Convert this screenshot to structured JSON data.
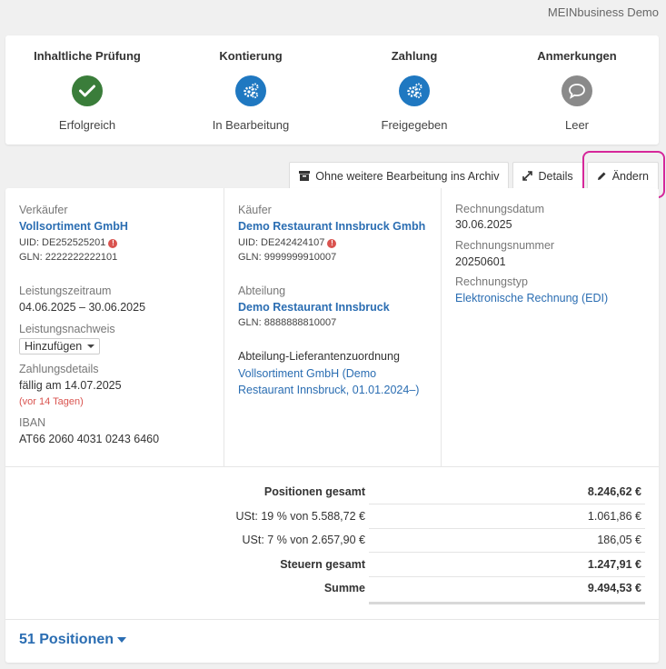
{
  "brand": "MEINbusiness Demo",
  "steps": [
    {
      "title": "Inhaltliche Prüfung",
      "status": "Erfolgreich",
      "icon": "check-icon",
      "color": "#3a7d3a"
    },
    {
      "title": "Kontierung",
      "status": "In Bearbeitung",
      "icon": "gears-icon",
      "color": "#1f78c1"
    },
    {
      "title": "Zahlung",
      "status": "Freigegeben",
      "icon": "gears-icon",
      "color": "#1f78c1"
    },
    {
      "title": "Anmerkungen",
      "status": "Leer",
      "icon": "comment-icon",
      "color": "#8a8a8a"
    }
  ],
  "tabs": {
    "archive": "Ohne weitere Bearbeitung ins Archiv",
    "details": "Details",
    "edit": "Ändern"
  },
  "seller": {
    "label": "Verkäufer",
    "name": "Vollsortiment GmbH",
    "uid": "UID: DE252525201",
    "gln": "GLN: 2222222222101"
  },
  "period": {
    "label": "Leistungszeitraum",
    "value": "04.06.2025 – 30.06.2025"
  },
  "proof": {
    "label": "Leistungsnachweis",
    "button": "Hinzufügen"
  },
  "payment": {
    "label": "Zahlungsdetails",
    "due": "fällig am 14.07.2025",
    "overdue": "(vor 14 Tagen)"
  },
  "iban": {
    "label": "IBAN",
    "value": "AT66 2060 4031 0243 6460"
  },
  "buyer": {
    "label": "Käufer",
    "name": "Demo Restaurant Innsbruck Gmbh",
    "uid": "UID: DE242424107",
    "gln": "GLN: 9999999910007"
  },
  "department": {
    "label": "Abteilung",
    "name": "Demo Restaurant Innsbruck",
    "gln": "GLN: 8888888810007"
  },
  "supplier_assignment": {
    "label": "Abteilung-Lieferantenzuordnung",
    "line1": "Vollsortiment GmbH (Demo",
    "line2": "Restaurant Innsbruck, 01.01.2024–)"
  },
  "invoice": {
    "date_label": "Rechnungsdatum",
    "date": "30.06.2025",
    "number_label": "Rechnungsnummer",
    "number": "20250601",
    "type_label": "Rechnungstyp",
    "type": "Elektronische Rechnung (EDI)"
  },
  "totals": {
    "positions_label": "Positionen gesamt",
    "positions_value": "8.246,62 €",
    "vat19_label": "USt: 19 % von 5.588,72 €",
    "vat19_value": "1.061,86 €",
    "vat7_label": "USt: 7 % von 2.657,90 €",
    "vat7_value": "186,05 €",
    "tax_label": "Steuern gesamt",
    "tax_value": "1.247,91 €",
    "sum_label": "Summe",
    "sum_value": "9.494,53 €"
  },
  "positions_toggle": "51 Positionen"
}
